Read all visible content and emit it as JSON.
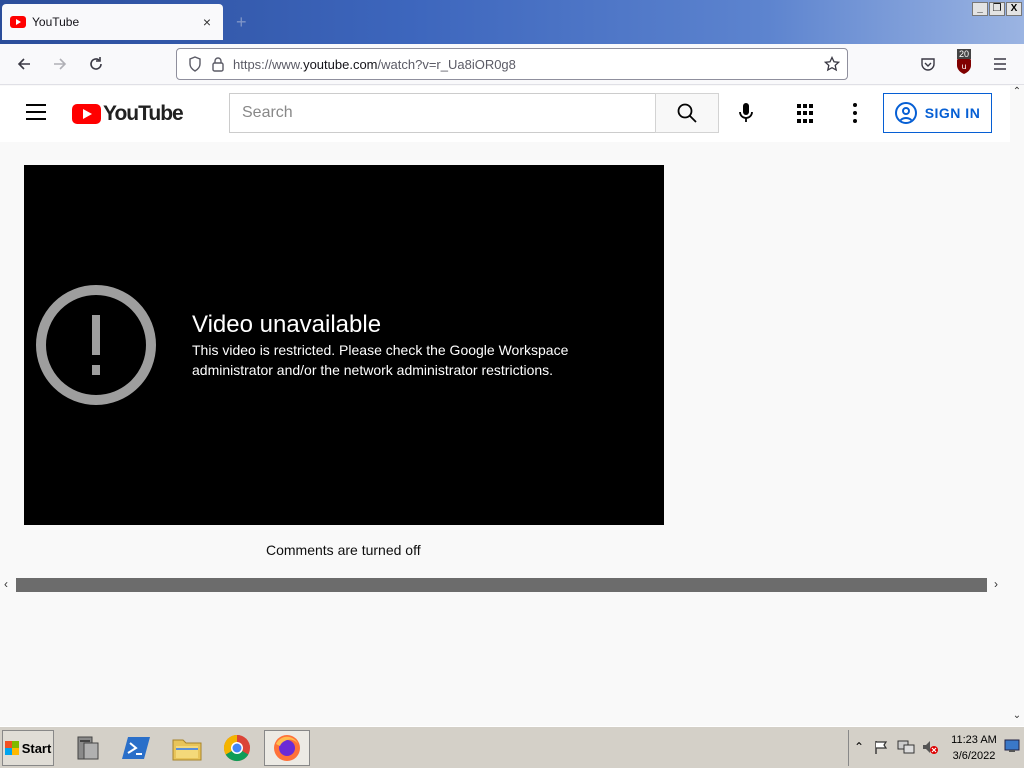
{
  "browser": {
    "tab_title": "YouTube",
    "tab_close": "×",
    "new_tab": "+",
    "url_prefix": "https://www.",
    "url_domain": "youtube.com",
    "url_path": "/watch?v=r_Ua8iOR0g8",
    "extension_badge": "20",
    "window_buttons": [
      "_",
      "❐",
      "X"
    ]
  },
  "youtube": {
    "logo_text": "YouTube",
    "search_placeholder": "Search",
    "sign_in_label": "SIGN IN"
  },
  "player": {
    "error_title": "Video unavailable",
    "error_message": "This video is restricted. Please check the Google Workspace administrator and/or the network administrator restrictions."
  },
  "comments_text": "Comments are turned off",
  "taskbar": {
    "start_label": "Start",
    "time": "11:23 AM",
    "date": "3/6/2022"
  },
  "colors": {
    "youtube_red": "#ff0000",
    "signin_blue": "#065fd4",
    "player_bg": "#000000",
    "error_icon": "#9e9e9e"
  }
}
